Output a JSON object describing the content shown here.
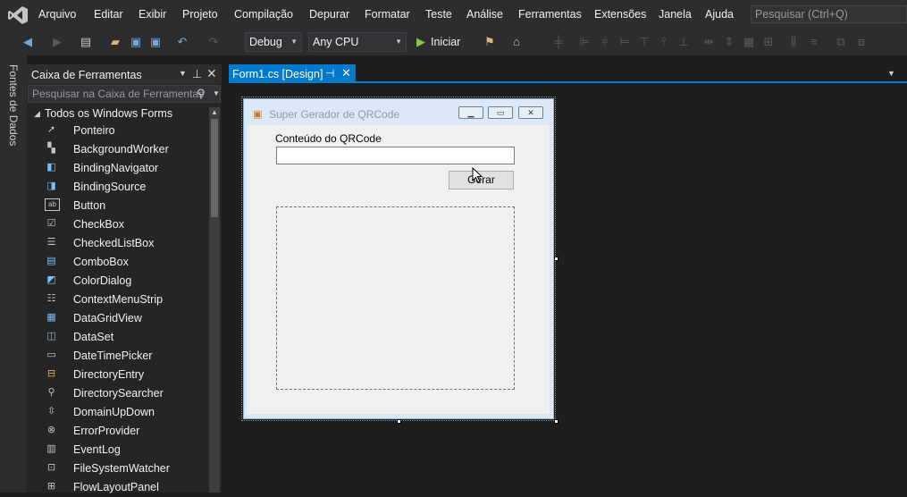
{
  "menu": {
    "items": [
      "Arquivo",
      "Editar",
      "Exibir",
      "Projeto",
      "Compilação",
      "Depurar",
      "Formatar",
      "Teste",
      "Análise",
      "Ferramentas",
      "Extensões",
      "Janela",
      "Ajuda"
    ],
    "search_placeholder": "Pesquisar (Ctrl+Q)"
  },
  "toolbar": {
    "config": "Debug",
    "platform": "Any CPU",
    "start_label": "Iniciar"
  },
  "side_tab": {
    "label": "Fontes de Dados"
  },
  "toolbox": {
    "title": "Caixa de Ferramentas",
    "search_placeholder": "Pesquisar na Caixa de Ferramentas",
    "category": "Todos os Windows Forms",
    "items": [
      {
        "label": "Ponteiro",
        "icon": "pointer-icon"
      },
      {
        "label": "BackgroundWorker",
        "icon": "worker-icon"
      },
      {
        "label": "BindingNavigator",
        "icon": "navigator-icon"
      },
      {
        "label": "BindingSource",
        "icon": "binding-icon"
      },
      {
        "label": "Button",
        "icon": "button-icon"
      },
      {
        "label": "CheckBox",
        "icon": "checkbox-icon"
      },
      {
        "label": "CheckedListBox",
        "icon": "checked-list-icon"
      },
      {
        "label": "ComboBox",
        "icon": "combobox-icon"
      },
      {
        "label": "ColorDialog",
        "icon": "color-dialog-icon"
      },
      {
        "label": "ContextMenuStrip",
        "icon": "context-menu-icon"
      },
      {
        "label": "DataGridView",
        "icon": "grid-icon"
      },
      {
        "label": "DataSet",
        "icon": "dataset-icon"
      },
      {
        "label": "DateTimePicker",
        "icon": "datetime-icon"
      },
      {
        "label": "DirectoryEntry",
        "icon": "directory-entry-icon"
      },
      {
        "label": "DirectorySearcher",
        "icon": "search-icon"
      },
      {
        "label": "DomainUpDown",
        "icon": "updown-icon"
      },
      {
        "label": "ErrorProvider",
        "icon": "error-icon"
      },
      {
        "label": "EventLog",
        "icon": "eventlog-icon"
      },
      {
        "label": "FileSystemWatcher",
        "icon": "watcher-icon"
      },
      {
        "label": "FlowLayoutPanel",
        "icon": "flow-panel-icon"
      }
    ]
  },
  "document": {
    "tab_label": "Form1.cs [Design]"
  },
  "form": {
    "title": "Super Gerador de QRCode",
    "label": "Conteúdo do QRCode",
    "input_value": "",
    "button_label": "Gerar"
  }
}
